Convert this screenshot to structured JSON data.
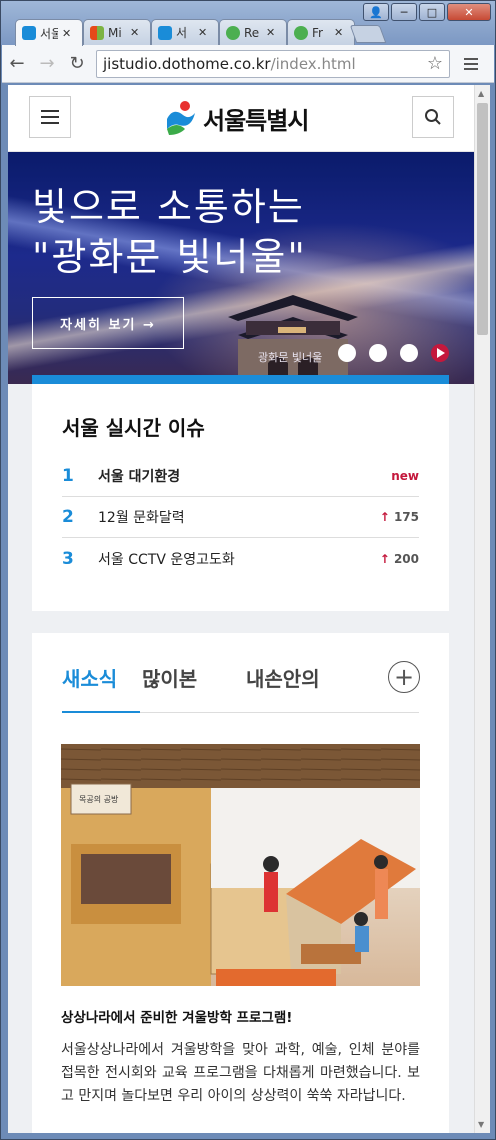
{
  "browser": {
    "tabs": [
      {
        "label": "서울",
        "favicon_color": "#1a8cd8",
        "active": true
      },
      {
        "label": "Mi",
        "favicon_color": "#e64a19",
        "active": false
      },
      {
        "label": "서",
        "favicon_color": "#1a8cd8",
        "active": false
      },
      {
        "label": "Re",
        "favicon_color": "#4caf50",
        "active": false
      },
      {
        "label": "Fr",
        "favicon_color": "#4caf50",
        "active": false
      }
    ],
    "url_host": "jistudio.dothome.co.kr",
    "url_path": "/index.html",
    "window_buttons": {
      "user": "👤",
      "minimize": "─",
      "maximize": "□",
      "close": "✕"
    },
    "tab_close": "✕",
    "nav": {
      "back": "←",
      "forward": "→",
      "reload": "↻",
      "star": "☆"
    }
  },
  "site": {
    "logo_text": "서울특별시",
    "hero": {
      "title_line1": "빛으로 소통하는",
      "title_line2": "\"광화문 빛너울\"",
      "button_label": "자세히 보기 →",
      "image_caption": "광화문 빛너울"
    },
    "issues": {
      "heading": "서울 실시간 이슈",
      "items": [
        {
          "rank": "1",
          "title": "서울 대기환경",
          "badge": "new"
        },
        {
          "rank": "2",
          "title": "12월 문화달력",
          "arrow": "↑",
          "count": "175"
        },
        {
          "rank": "3",
          "title": "서울 CCTV 운영고도화",
          "arrow": "↑",
          "count": "200"
        }
      ]
    },
    "news": {
      "tabs": [
        "새소식",
        "많이본",
        "내손안의"
      ],
      "active_tab": "새소식",
      "more_icon": "+",
      "photo_sign": "목공의 공방",
      "headline": "상상나라에서 준비한 겨울방학 프로그램!",
      "body": "서울상상나라에서 겨울방학을 맞아 과학, 예술, 인체 분야를 접목한 전시회와 교육 프로그램을 다채롭게 마련했습니다. 보고 만지며 놀다보면 우리 아이의 상상력이 쑥쑥 자라납니다."
    }
  }
}
